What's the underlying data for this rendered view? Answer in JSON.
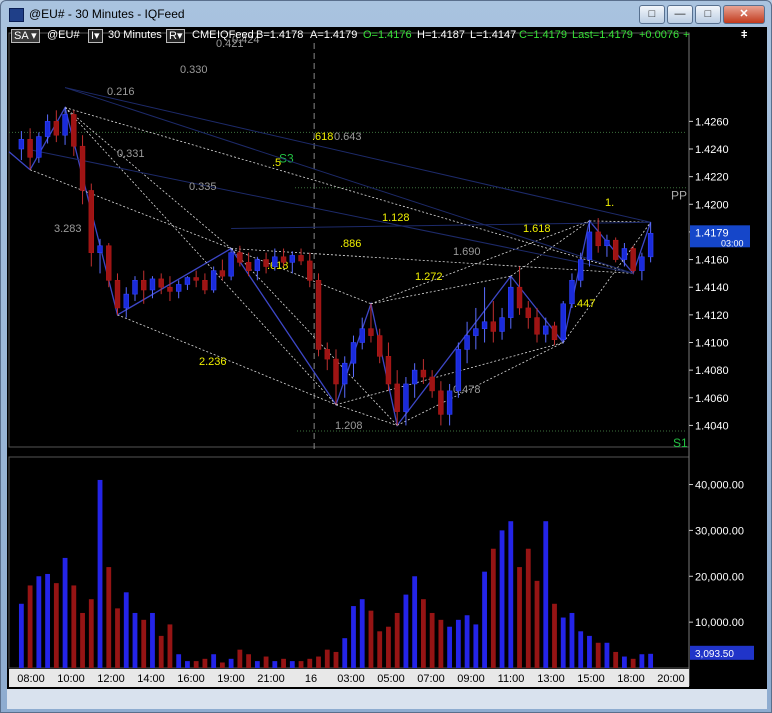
{
  "window": {
    "title": "@EU# - 30 Minutes - IQFeed",
    "buttons": [
      "□",
      "—",
      "□",
      "✕"
    ]
  },
  "toolbar": {
    "sa": "SA",
    "sa_arrow": "▾",
    "symbol": "@EU#",
    "interval_box": "I▾",
    "interval": "30 Minutes",
    "r_box": "R▾",
    "exchange": "CME",
    "feed": "IQFeed",
    "bid": "B=1.4178",
    "ask": "A=1.4179",
    "open": "O=1.4176",
    "high": "H=1.4187",
    "low": "L=1.4147",
    "close": "C=1.4179",
    "last": "Last=1.4179",
    "change": "+0.0076",
    "plus": "+",
    "menu_icon": "ǂ"
  },
  "colors": {
    "bull": "#1a2bdb",
    "bear": "#9e1414",
    "zigzag": "#3d47c7",
    "ratio_yellow": "#f0f000",
    "ratio_grey": "#9a9a9a",
    "level_green": "#23c243",
    "axis_text": "#ffffff",
    "last_price_bg": "#1546c9"
  },
  "chart_data": [
    {
      "type": "candlestick",
      "x_tick_labels": [
        "08:00",
        "10:00",
        "12:00",
        "14:00",
        "16:00",
        "19:00",
        "21:00",
        "16",
        "03:00",
        "05:00",
        "07:00",
        "09:00",
        "11:00",
        "13:00",
        "15:00",
        "18:00",
        "20:00"
      ],
      "y_ticks": [
        1.404,
        1.406,
        1.408,
        1.41,
        1.412,
        1.414,
        1.416,
        1.418,
        1.42,
        1.422,
        1.424,
        1.426
      ],
      "y_tick_labels": [
        "1.4040",
        "1.4060",
        "1.4080",
        "1.4100",
        "1.4120",
        "1.4140",
        "1.4160",
        "1.4180",
        "1.4200",
        "1.4220",
        "1.4240",
        "1.4260"
      ],
      "ylim": [
        1.4028,
        1.4295
      ],
      "last_price": 1.4179,
      "last_price_label": "1.4179",
      "bar_timer": "03:00",
      "levels": [
        {
          "name": "S3",
          "value": 1.4252
        },
        {
          "name": "PP",
          "value": 1.4212
        },
        {
          "name": "S1",
          "value": 1.4036
        }
      ],
      "grey_ratio_labels": [
        "0.330",
        "0.216",
        "0.331",
        "0.335",
        "3.283",
        "0.643",
        "1.690",
        "0.478",
        "1.208",
        "0.421",
        "0.424"
      ],
      "yellow_ratio_labels": [
        ".618",
        ".5",
        "1.128",
        ".886",
        ".618",
        "2.236",
        "1.272",
        "1.618",
        ".447",
        "1."
      ],
      "ohlc": [
        [
          1.424,
          1.4253,
          1.4232,
          1.4247
        ],
        [
          1.4247,
          1.4255,
          1.4225,
          1.4234
        ],
        [
          1.4234,
          1.4252,
          1.423,
          1.4249
        ],
        [
          1.4249,
          1.4265,
          1.4244,
          1.426
        ],
        [
          1.426,
          1.4268,
          1.4245,
          1.425
        ],
        [
          1.425,
          1.427,
          1.4243,
          1.4265
        ],
        [
          1.4265,
          1.4268,
          1.4235,
          1.4242
        ],
        [
          1.4242,
          1.425,
          1.42,
          1.421
        ],
        [
          1.421,
          1.4215,
          1.4155,
          1.4165
        ],
        [
          1.4165,
          1.4175,
          1.415,
          1.417
        ],
        [
          1.417,
          1.4172,
          1.414,
          1.4145
        ],
        [
          1.4145,
          1.415,
          1.412,
          1.4125
        ],
        [
          1.4125,
          1.414,
          1.4118,
          1.4135
        ],
        [
          1.4135,
          1.4148,
          1.413,
          1.4145
        ],
        [
          1.4145,
          1.4152,
          1.4128,
          1.4138
        ],
        [
          1.4138,
          1.4148,
          1.4132,
          1.4146
        ],
        [
          1.4146,
          1.415,
          1.4135,
          1.414
        ],
        [
          1.414,
          1.4148,
          1.413,
          1.4137
        ],
        [
          1.4137,
          1.4145,
          1.4132,
          1.4142
        ],
        [
          1.4142,
          1.4148,
          1.4138,
          1.4147
        ],
        [
          1.4147,
          1.4152,
          1.414,
          1.4145
        ],
        [
          1.4145,
          1.415,
          1.4135,
          1.4138
        ],
        [
          1.4138,
          1.4155,
          1.4136,
          1.4152
        ],
        [
          1.4152,
          1.416,
          1.4145,
          1.4148
        ],
        [
          1.4148,
          1.4168,
          1.4145,
          1.4165
        ],
        [
          1.4165,
          1.417,
          1.4155,
          1.4158
        ],
        [
          1.4158,
          1.4165,
          1.4148,
          1.4152
        ],
        [
          1.4152,
          1.4162,
          1.4145,
          1.416
        ],
        [
          1.416,
          1.4165,
          1.415,
          1.4155
        ],
        [
          1.4155,
          1.4168,
          1.4152,
          1.4162
        ],
        [
          1.4162,
          1.4168,
          1.4155,
          1.4158
        ],
        [
          1.4158,
          1.4166,
          1.415,
          1.4163
        ],
        [
          1.4163,
          1.4168,
          1.4156,
          1.4159
        ],
        [
          1.4159,
          1.4165,
          1.414,
          1.4145
        ],
        [
          1.4145,
          1.415,
          1.409,
          1.4095
        ],
        [
          1.4095,
          1.41,
          1.408,
          1.4088
        ],
        [
          1.4088,
          1.4095,
          1.4055,
          1.407
        ],
        [
          1.407,
          1.409,
          1.406,
          1.4085
        ],
        [
          1.4085,
          1.4105,
          1.4075,
          1.41
        ],
        [
          1.41,
          1.4118,
          1.4095,
          1.411
        ],
        [
          1.411,
          1.4128,
          1.41,
          1.4105
        ],
        [
          1.4105,
          1.411,
          1.4085,
          1.409
        ],
        [
          1.409,
          1.41,
          1.4065,
          1.407
        ],
        [
          1.407,
          1.408,
          1.404,
          1.405
        ],
        [
          1.405,
          1.4075,
          1.404,
          1.407
        ],
        [
          1.407,
          1.4085,
          1.406,
          1.408
        ],
        [
          1.408,
          1.4088,
          1.407,
          1.4075
        ],
        [
          1.4075,
          1.408,
          1.406,
          1.4065
        ],
        [
          1.4065,
          1.4072,
          1.404,
          1.4048
        ],
        [
          1.4048,
          1.407,
          1.404,
          1.4065
        ],
        [
          1.4065,
          1.41,
          1.406,
          1.4095
        ],
        [
          1.4095,
          1.4115,
          1.4085,
          1.4105
        ],
        [
          1.4105,
          1.4125,
          1.4095,
          1.411
        ],
        [
          1.411,
          1.414,
          1.41,
          1.4115
        ],
        [
          1.4115,
          1.413,
          1.41,
          1.4108
        ],
        [
          1.4108,
          1.4125,
          1.4102,
          1.4118
        ],
        [
          1.4118,
          1.4148,
          1.411,
          1.414
        ],
        [
          1.414,
          1.4155,
          1.412,
          1.4125
        ],
        [
          1.4125,
          1.413,
          1.411,
          1.4118
        ],
        [
          1.4118,
          1.4125,
          1.41,
          1.4106
        ],
        [
          1.4106,
          1.4118,
          1.41,
          1.4112
        ],
        [
          1.4112,
          1.4115,
          1.4098,
          1.4102
        ],
        [
          1.4102,
          1.413,
          1.41,
          1.4128
        ],
        [
          1.4128,
          1.415,
          1.4125,
          1.4145
        ],
        [
          1.4145,
          1.4165,
          1.414,
          1.416
        ],
        [
          1.416,
          1.4188,
          1.4155,
          1.418
        ],
        [
          1.418,
          1.419,
          1.4165,
          1.417
        ],
        [
          1.417,
          1.4178,
          1.4162,
          1.4174
        ],
        [
          1.4174,
          1.4176,
          1.4158,
          1.416
        ],
        [
          1.416,
          1.4172,
          1.4155,
          1.4168
        ],
        [
          1.4168,
          1.417,
          1.415,
          1.4152
        ],
        [
          1.4152,
          1.4165,
          1.4145,
          1.4162
        ],
        [
          1.4162,
          1.4187,
          1.4158,
          1.4179
        ]
      ]
    },
    {
      "type": "bar",
      "name": "volume",
      "y_ticks": [
        10000,
        20000,
        30000,
        40000
      ],
      "y_tick_labels": [
        "10,000.00",
        "20,000.00",
        "30,000.00",
        "40,000.00"
      ],
      "ylim": [
        0,
        46000
      ],
      "last_volume_label": "3,093.50",
      "values": [
        14000,
        18000,
        20000,
        20500,
        18500,
        24000,
        18000,
        12000,
        15000,
        41000,
        22000,
        13000,
        16500,
        12000,
        10500,
        12000,
        7000,
        9500,
        3000,
        1500,
        1500,
        2000,
        3000,
        1200,
        2000,
        4000,
        3000,
        1500,
        2500,
        1500,
        2000,
        1500,
        1500,
        2000,
        2500,
        4000,
        3500,
        6500,
        13500,
        15000,
        12500,
        8000,
        9000,
        12000,
        16000,
        20000,
        15000,
        12000,
        10500,
        9000,
        10500,
        11500,
        9500,
        21000,
        26000,
        30000,
        32000,
        22000,
        26000,
        19000,
        32000,
        14000,
        11000,
        12000,
        8000,
        7000,
        5500,
        5500,
        3500,
        2500,
        2000,
        3000,
        3093.5
      ]
    }
  ]
}
